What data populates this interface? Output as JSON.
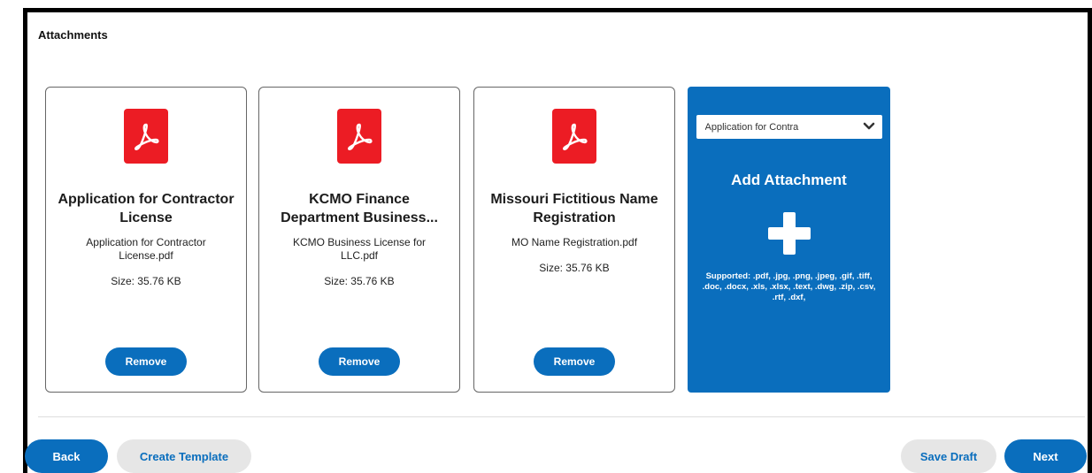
{
  "section": {
    "title": "Attachments"
  },
  "attachments": [
    {
      "title": "Application for Contractor License",
      "file_name": "Application for Contractor License.pdf",
      "size": "Size: 35.76 KB",
      "remove_label": "Remove",
      "icon": "pdf-icon"
    },
    {
      "title": "KCMO Finance Department Business...",
      "file_name": "KCMO Business License for LLC.pdf",
      "size": "Size: 35.76 KB",
      "remove_label": "Remove",
      "icon": "pdf-icon"
    },
    {
      "title": "Missouri Fictitious Name Registration",
      "file_name": "MO Name Registration.pdf",
      "size": "Size: 35.76 KB",
      "remove_label": "Remove",
      "icon": "pdf-icon"
    }
  ],
  "add_attachment": {
    "type_selected": "Application for Contra",
    "title": "Add Attachment",
    "supported_text": "Supported: .pdf, .jpg, .png, .jpeg, .gif, .tiff, .doc, .docx, .xls, .xlsx, .text, .dwg, .zip, .csv, .rtf, .dxf,"
  },
  "footer": {
    "back_label": "Back",
    "create_template_label": "Create Template",
    "save_draft_label": "Save Draft",
    "next_label": "Next"
  },
  "colors": {
    "primary": "#0a6ebd",
    "pdf_red": "#ec1c24",
    "secondary_bg": "#e6e6e6"
  }
}
